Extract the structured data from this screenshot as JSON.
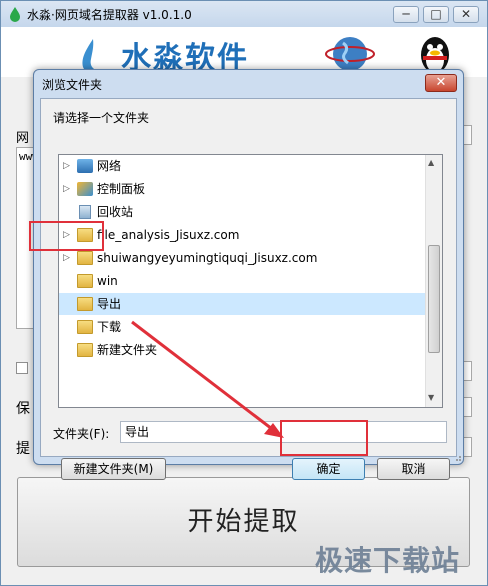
{
  "main": {
    "title": "水淼·网页域名提取器 v1.0.1.0",
    "minimize": "─",
    "maximize": "□",
    "close": "✕",
    "logo_text": "水淼软件",
    "label_1": "网",
    "textarea_text": "www",
    "save_label": "保",
    "extract_label": "提",
    "start_button": "开始提取"
  },
  "dialog": {
    "title": "浏览文件夹",
    "close": "✕",
    "prompt": "请选择一个文件夹",
    "tree": [
      {
        "label": "网络",
        "icon": "network-icon",
        "arrow": true
      },
      {
        "label": "控制面板",
        "icon": "control-panel-icon",
        "arrow": true
      },
      {
        "label": "回收站",
        "icon": "recycle-bin-icon",
        "arrow": false
      },
      {
        "label": "file_analysis_Jisuxz.com",
        "icon": "folder-icon",
        "arrow": true
      },
      {
        "label": "shuiwangyeyumingtiquqi_Jisuxz.com",
        "icon": "folder-icon",
        "arrow": true
      },
      {
        "label": "win",
        "icon": "folder-icon",
        "arrow": false
      },
      {
        "label": "导出",
        "icon": "folder-icon",
        "arrow": false,
        "selected": true
      },
      {
        "label": "下载",
        "icon": "folder-icon",
        "arrow": false
      },
      {
        "label": "新建文件夹",
        "icon": "folder-icon",
        "arrow": false
      }
    ],
    "folder_label": "文件夹(F):",
    "folder_value": "导出",
    "new_folder_button": "新建文件夹(M)",
    "ok_button": "确定",
    "cancel_button": "取消"
  },
  "watermark": "极速下载站",
  "colors": {
    "highlight_red": "#e0303a",
    "selected_bg": "#cce8ff",
    "accent_blue": "#1f6fb8"
  }
}
